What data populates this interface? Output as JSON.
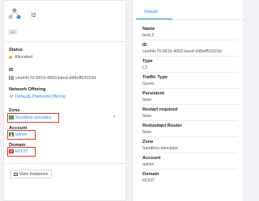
{
  "header": {
    "title": "l2",
    "type_tag": "L2"
  },
  "left": {
    "status": {
      "label": "Status",
      "value": "Allocated"
    },
    "id": {
      "label": "ID",
      "value": "cee44c70-6816-4650-beed-d98eff52023d"
    },
    "network_offering": {
      "label": "Network Offering",
      "value": "DefaultL2NetworkOffering"
    },
    "zone": {
      "label": "Zone",
      "value": "Sandbox-simulator"
    },
    "account": {
      "label": "Account",
      "value": "admin"
    },
    "domain": {
      "label": "Domain",
      "value": "ROOT"
    },
    "view_instances_button": "View Instances"
  },
  "right": {
    "tab": "Details",
    "fields": [
      {
        "label": "Name",
        "value": "testL2"
      },
      {
        "label": "ID",
        "value": "cee44c70-6816-4650-beed-d98eff52023d"
      },
      {
        "label": "Type",
        "value": "L2"
      },
      {
        "label": "Traffic Type",
        "value": "Guest"
      },
      {
        "label": "Persistent",
        "value": "false"
      },
      {
        "label": "Restart required",
        "value": "false"
      },
      {
        "label": "Redundant Router",
        "value": "false"
      },
      {
        "label": "Zone",
        "value": "Sandbox-simulator"
      },
      {
        "label": "Account",
        "value": "admin"
      },
      {
        "label": "Domain",
        "value": "ROOT"
      }
    ]
  },
  "colors": {
    "accent": "#1890ff",
    "highlight": "#e53935",
    "status": "#faad14"
  }
}
